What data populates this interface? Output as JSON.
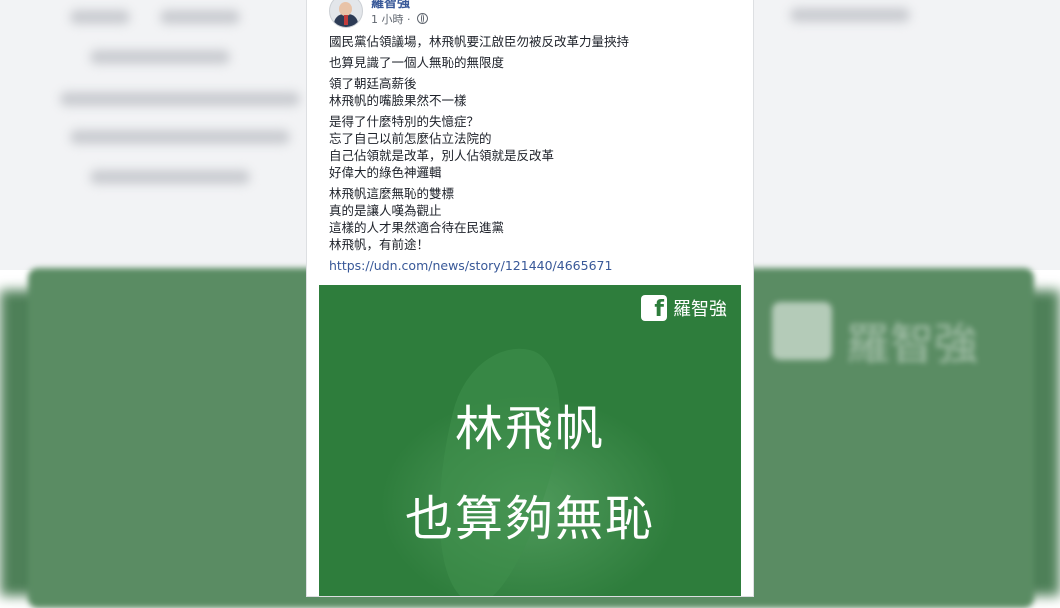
{
  "post": {
    "author": "羅智強",
    "time": "1 小時",
    "separator": "·",
    "paragraphs": [
      [
        "國民黨佔領議場，林飛帆要江啟臣勿被反改革力量挾持"
      ],
      [
        "也算見識了一個人無恥的無限度"
      ],
      [
        "領了朝廷高薪後",
        "林飛帆的嘴臉果然不一樣"
      ],
      [
        "是得了什麼特別的失憶症？",
        "忘了自己以前怎麼佔立法院的",
        "自己佔領就是改革，別人佔領就是反改革",
        "好偉大的綠色神邏輯"
      ],
      [
        "林飛帆這麼無恥的雙標",
        "真的是讓人嘆為觀止",
        "這樣的人才果然適合待在民進黨",
        "林飛帆，有前途！"
      ]
    ],
    "link": "https://udn.com/news/story/121440/4665671"
  },
  "image": {
    "watermark_icon": "f",
    "watermark_name": "羅智強",
    "line1": "林飛帆",
    "line2": "也算夠無恥"
  },
  "background": {
    "blurred_watermark_text": "羅智強"
  },
  "colors": {
    "link": "#385898",
    "image_green": "#2e7d3c",
    "background_green": "#5a8c63"
  }
}
